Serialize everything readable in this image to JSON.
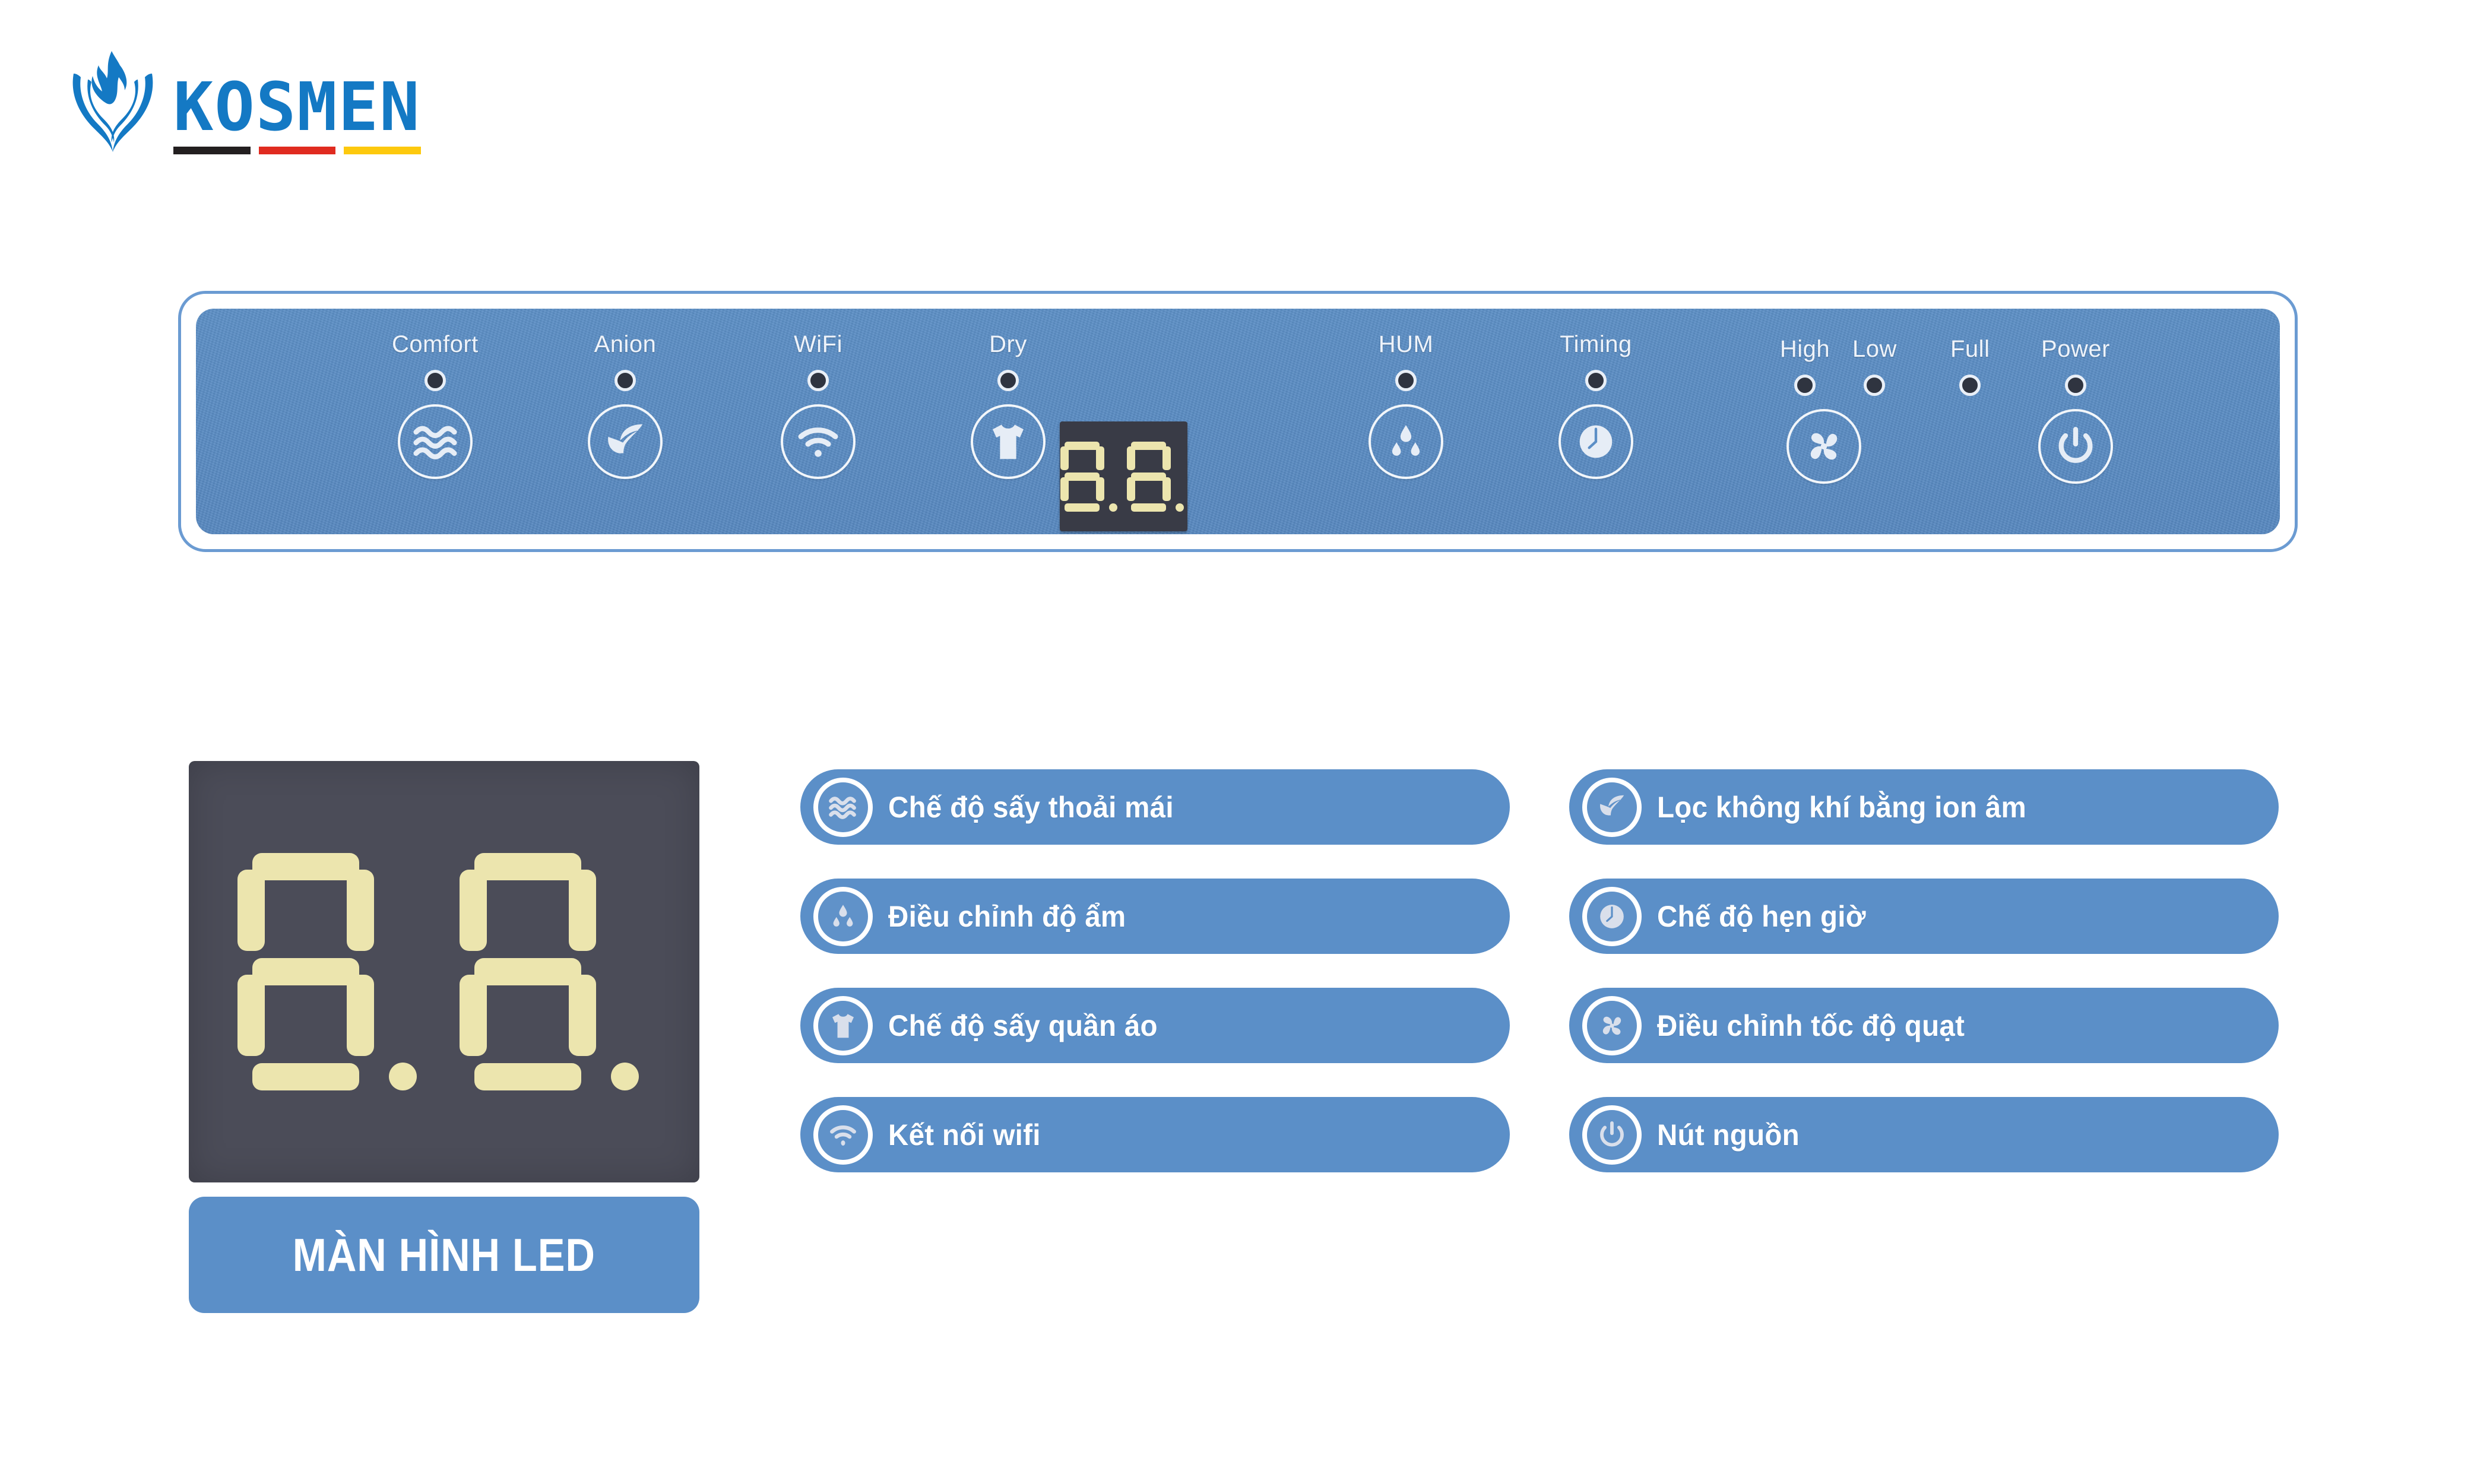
{
  "brand": {
    "name": "KOSMEN",
    "logo_icon": "phoenix-flame-icon",
    "logo_color": "#1479c4",
    "bar_colors": [
      "#231f20",
      "#e02b20",
      "#fdc90e"
    ]
  },
  "control_panel": {
    "panel_color": "#5c8fc6",
    "border_color": "#6b9bd2",
    "led_display": {
      "value": "8.8.",
      "background": "#393b46",
      "segment_color": "#ece5ae",
      "digits": [
        "8.",
        "8."
      ]
    },
    "keys": [
      {
        "label": "Comfort",
        "icon": "waves-icon",
        "led": true,
        "button": true
      },
      {
        "label": "Anion",
        "icon": "leaf-icon",
        "led": true,
        "button": true
      },
      {
        "label": "WiFi",
        "icon": "wifi-icon",
        "led": true,
        "button": true
      },
      {
        "label": "Dry",
        "icon": "tshirt-icon",
        "led": true,
        "button": true
      },
      {
        "label": "HUM",
        "icon": "water-drops-icon",
        "led": true,
        "button": true
      },
      {
        "label": "Timing",
        "icon": "clock-icon",
        "led": true,
        "button": true
      },
      {
        "label": "High",
        "icon": "fan-icon",
        "led": true,
        "button": true
      },
      {
        "label": "Low",
        "icon": "",
        "led": true,
        "button": false
      },
      {
        "label": "Full",
        "icon": "",
        "led": true,
        "button": false
      },
      {
        "label": "Power",
        "icon": "power-icon",
        "led": true,
        "button": true
      }
    ]
  },
  "led_screen_card": {
    "caption": "MÀN HÌNH LED",
    "display_value": "8.8.",
    "background": "#4b4c58",
    "segment_color": "#ece5ae",
    "caption_background": "#5b8fc8"
  },
  "features": [
    {
      "icon": "waves-icon",
      "label": "Chế độ sấy thoải mái"
    },
    {
      "icon": "leaf-icon",
      "label": "Lọc không khí bằng ion âm"
    },
    {
      "icon": "water-drops-icon",
      "label": "Điều chỉnh độ ẩm"
    },
    {
      "icon": "clock-icon",
      "label": "Chế độ hẹn giờ"
    },
    {
      "icon": "tshirt-icon",
      "label": "Chế độ sấy quần áo"
    },
    {
      "icon": "fan-icon",
      "label": "Điều chỉnh tốc độ quạt"
    },
    {
      "icon": "wifi-icon",
      "label": "Kết nối wifi"
    },
    {
      "icon": "power-icon",
      "label": "Nút nguồn"
    }
  ]
}
